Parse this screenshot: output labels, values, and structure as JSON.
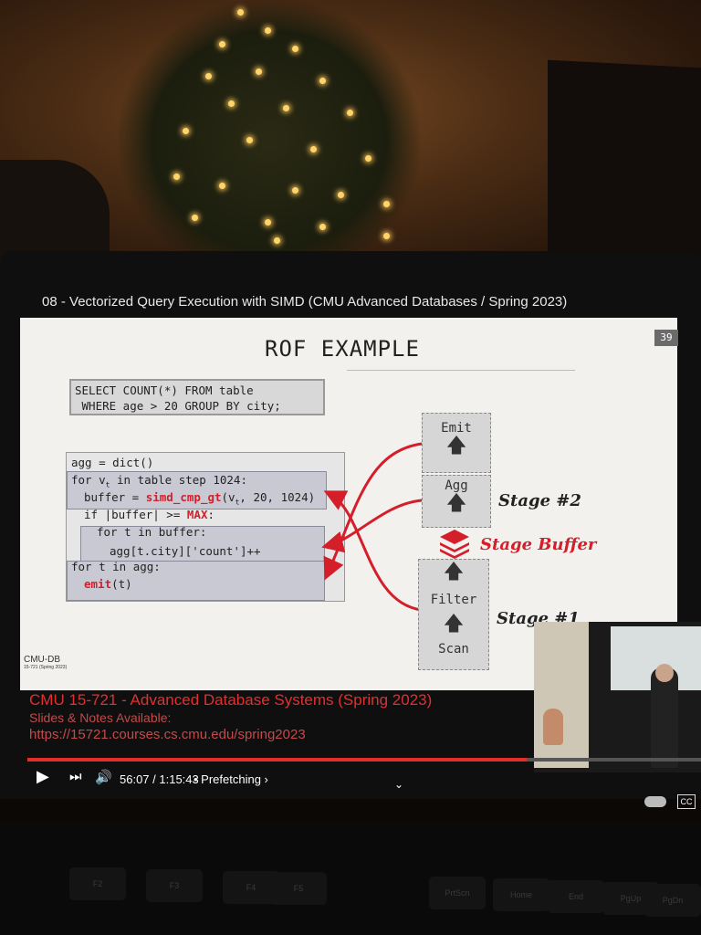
{
  "video": {
    "title": "08 - Vectorized Query Execution with SIMD (CMU Advanced Databases / Spring 2023)",
    "time_display": "56:07 / 1:15:43",
    "chapter": "• Prefetching ›",
    "progress_fraction": 0.741,
    "cc_label": "CC"
  },
  "slide": {
    "number": "39",
    "title": "ROF EXAMPLE",
    "sql_line1": "SELECT COUNT(*) FROM table",
    "sql_line2": " WHERE age > 20 GROUP BY city;",
    "code": {
      "l1": "agg = dict()",
      "l2a": "for v",
      "l2sub": "t",
      "l2b": " in table step 1024:",
      "l3a": "buffer = ",
      "l3fn": "simd_cmp_gt",
      "l3b": "(v",
      "l3sub": "t",
      "l3c": ", 20, 1024)",
      "l4a": "if |buffer| >= ",
      "l4max": "MAX",
      "l4b": ":",
      "l5": "for t in buffer:",
      "l6": "agg[t.city]['count']++",
      "l7": "for t in agg:",
      "l8fn": "emit",
      "l8b": "(t)"
    },
    "stages": {
      "emit": "Emit",
      "agg": "Agg",
      "filter": "Filter",
      "scan": "Scan",
      "stage2": "Stage #2",
      "stage_buffer": "Stage Buffer",
      "stage1": "Stage #1"
    },
    "footer_logo": "CMU-DB",
    "footer_sub": "15-721 (Spring 2023)"
  },
  "caption": {
    "line1": "CMU 15-721 - Advanced Database Systems (Spring 2023)",
    "line2": "Slides & Notes Available:",
    "line3": "https://15721.courses.cs.cmu.edu/spring2023"
  },
  "keyboard": {
    "keys": [
      "F2",
      "F3",
      "F4",
      "F5",
      "PrtScn",
      "Home",
      "End",
      "PgUp",
      "PgDn"
    ]
  },
  "colors": {
    "accent_red": "#d41f2b",
    "progress_red": "#e52d27"
  }
}
